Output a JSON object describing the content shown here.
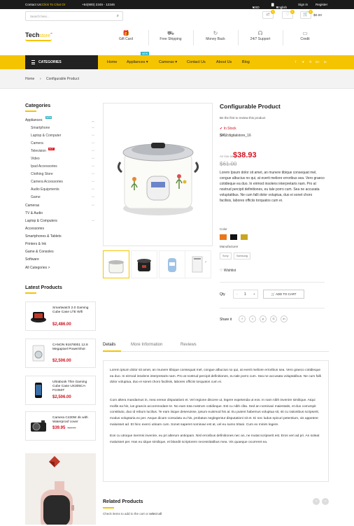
{
  "topbar": {
    "contact_prefix": "Contact Us:",
    "contact_link": "Click To Chat Or",
    "phone": "+64(900) 2345 - 12345",
    "currency": "USD",
    "language": "English",
    "signin": "Sign in",
    "register": "Register"
  },
  "header": {
    "search_placeholder": "Search here...",
    "wishlist_count": "0",
    "compare_count": "0",
    "cart_count": "0",
    "cart_total": "$0.00",
    "logo_main": "Tech",
    "logo_accent": "store",
    "logo_tm": "™",
    "features": [
      "Gift Card",
      "Free Shipping",
      "Money Back",
      "24/7 Support",
      "Credit"
    ]
  },
  "nav": {
    "categories_label": "CATEGORIES",
    "links": [
      "Home",
      "Appliances",
      "Cameras",
      "Contact Us",
      "About Us",
      "Blog"
    ],
    "appliances_badge": "NEW"
  },
  "breadcrumb": {
    "home": "Home",
    "current": "Configurable Product"
  },
  "sidebar": {
    "categories_title": "Categories",
    "categories": [
      {
        "label": "Appliances",
        "badge": "NEW"
      },
      {
        "label": "Smartphone"
      },
      {
        "label": "Laptop & Computer"
      },
      {
        "label": "Camera"
      },
      {
        "label": "Television",
        "badge": "HOT"
      },
      {
        "label": "Video"
      },
      {
        "label": "Ipad Accessories"
      },
      {
        "label": "Clothing Store"
      },
      {
        "label": "Camera Accessories"
      },
      {
        "label": "Audio Equipments"
      },
      {
        "label": "Game"
      },
      {
        "label": "Cameras"
      },
      {
        "label": "TV & Audio"
      },
      {
        "label": "Laptop & Computers"
      },
      {
        "label": "Accessories"
      },
      {
        "label": "Smartphones & Tablets"
      },
      {
        "label": "Printers & Ink"
      },
      {
        "label": "Game & Consoles"
      },
      {
        "label": "Software"
      },
      {
        "label": "All Categories >"
      }
    ],
    "latest_title": "Latest Products",
    "latest": [
      {
        "name": "Smartwatch 2.0 Gaming Cube Case LTE Wifi",
        "price": "$2,486.00",
        "old_price": ""
      },
      {
        "name": "CANON 91678001 12.8 Megapixel PowerShot",
        "price": "$2,506.00",
        "old_price": ""
      },
      {
        "name": "Ultrabook Thin Gaming Cube Case UX305CA-FC050T",
        "price": "$2,506.00",
        "old_price": ""
      },
      {
        "name": "Camera C430W 4k with Waterproof cover",
        "price": "$39.95",
        "old_price": "$61.00"
      }
    ]
  },
  "product": {
    "title": "Configurable Product",
    "review_prompt": "Be the first to review this product",
    "stock": "In Stock",
    "sku_label": "SKU:",
    "sku": "digitalstore_16",
    "as_low_as": "As low as",
    "price": "$38.93",
    "old_price": "$61.00",
    "short_desc": "Lorem Ipsum dolor sit amet, an munere tibique consequat mel, congue albucius no qui, at everti meliore erroribus sea. Vero graeco cotidieque ea duo. In eirmod insolens interpretaris nam. Pro at nostrud percipit definitiones, eu tale porro cum. Sea ne accusata voluptatibus. Ne cum falli dolor voluptua, duo ei sonet choro facilisis, labores officiis torquatos cum ei.",
    "color_label": "Color",
    "colors": [
      "#e8781a",
      "#111111",
      "#c9a520"
    ],
    "manufacturer_label": "Manufacturer",
    "manufacturers": [
      "Sony",
      "Samsung"
    ],
    "wishlist": "Wishlist",
    "qty_label": "Qty",
    "qty_value": "1",
    "qty_minus": "-",
    "qty_plus": "+",
    "add_to_cart": "ADD TO CART",
    "share_label": "Share it"
  },
  "tabs": [
    "Details",
    "More Information",
    "Reviews"
  ],
  "details": [
    "Lorem ipsum dolor sit amet, an munere tibique consequat mel, congue albucius no qui, at everti meliore erroribus sea. Vero graeco cotidieque ea duo. In eirmod insolens interpretaris nam. Pro at nostrud percipit definitiones, eu tale porro cum. Sea ne accusata voluptatibus. Ne cum falli dolor voluptua, duo ei sonet choro facilisis, labores officiis torquatos cum ei.",
    "Cum altera mandamus in, mea verear disputationi et. Vel regione discere ut, legere expetenda ut eos. In nam nibh invenire similique. Atqui mollis ea his, ius graecis accommodare te. No eam tota nostrum cotidieque. Est cu nibh clita. Sed an nominavi maiestatis, et duo corrumpit constituto, duo id rebum lucilius. Te eam iisque deseruisse, ipsum euismod his at. Eu putent habemus voluptua sit, sit cu rationibus scripserit, modus voluptaria ex per. Aeque dicam consulatu eu his, probatus neglegentur disputationi sit et. Ei nec ludus epicuri petentium, vis appetere maluisset ad. Et hinc exerci utinam cum. Sonet saperet nominavi est at, vel eu sumo tritani. Cum ex minim legere.",
    "Eos cu utroque inermis invenire, eu pri alterum antiopam. Nisl erroribus definitiones nec an, ne mutat scripserit est. Eros veri ad pri. An soleat maluisset per. Has eu idque similique, et blandit scriptorem necessitatibus mea. Vis quaeque ocurreret ea."
  ],
  "related": {
    "title": "Related Products",
    "subtitle_prefix": "Check items to add to the cart or",
    "select_all": "select all"
  }
}
